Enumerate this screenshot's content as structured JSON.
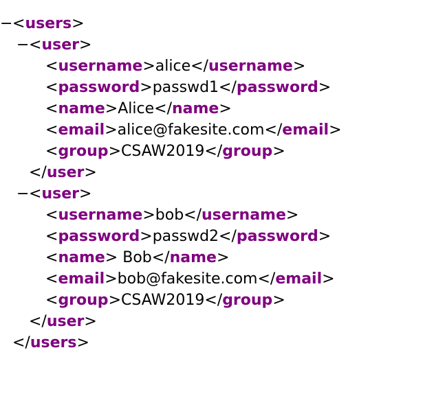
{
  "colors": {
    "tag": "#800080",
    "text": "#000000",
    "background": "#ffffff"
  },
  "toggle_symbol": "−",
  "root": {
    "tag": "users",
    "users": [
      {
        "tag": "user",
        "fields": [
          {
            "tag": "username",
            "value": "alice"
          },
          {
            "tag": "password",
            "value": "passwd1"
          },
          {
            "tag": "name",
            "value": "Alice"
          },
          {
            "tag": "email",
            "value": "alice@fakesite.com"
          },
          {
            "tag": "group",
            "value": "CSAW2019"
          }
        ]
      },
      {
        "tag": "user",
        "fields": [
          {
            "tag": "username",
            "value": "bob"
          },
          {
            "tag": "password",
            "value": "passwd2"
          },
          {
            "tag": "name",
            "value": " Bob"
          },
          {
            "tag": "email",
            "value": "bob@fakesite.com"
          },
          {
            "tag": "group",
            "value": "CSAW2019"
          }
        ]
      }
    ]
  }
}
